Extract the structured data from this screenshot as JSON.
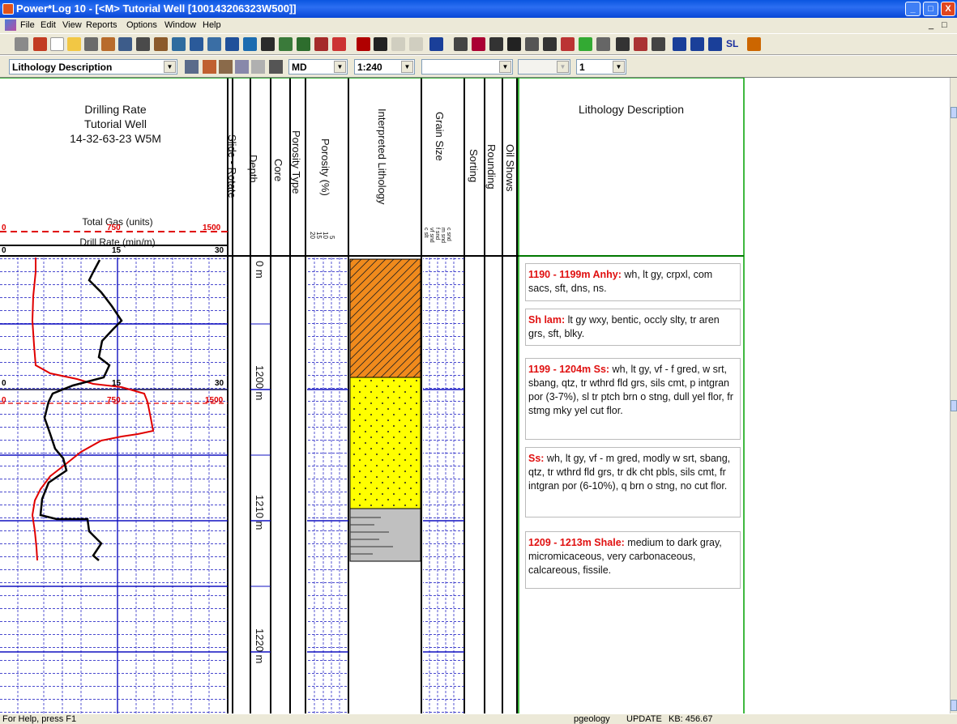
{
  "window": {
    "title": "Power*Log 10 - [<M> Tutorial Well [100143206323W500]]",
    "buttons": [
      "_",
      "□",
      "X"
    ]
  },
  "menu": {
    "items": [
      "File",
      "Edit",
      "View",
      "Reports",
      "Options",
      "Window",
      "Help"
    ],
    "mdi_buttons": [
      "_",
      "□"
    ]
  },
  "toolbar2": {
    "view_select": "Lithology Description",
    "depth_select": "MD",
    "scale_select": "1:240",
    "blank_select": "",
    "disabled_select": "",
    "page_select": "1",
    "sl_label": "SL"
  },
  "headers": {
    "drill_title_1": "Drilling Rate",
    "drill_title_2": "Tutorial Well",
    "drill_title_3": "14-32-63-23 W5M",
    "total_gas": "Total Gas (units)",
    "gas_min": "0",
    "gas_mid": "750",
    "gas_max": "1500",
    "drill_rate": "Drill Rate (min/m)",
    "rate_min": "0",
    "rate_mid": "15",
    "rate_max": "30",
    "slide_rotate": "Slide - Rotate",
    "depth": "Depth",
    "core": "Core",
    "porosity_type": "Porosity Type",
    "porosity": "Porosity (%)",
    "porosity_scale": [
      "20",
      "15",
      "10",
      "5"
    ],
    "interpreted_lithology": "Interpreted Lithology",
    "grain_size": "Grain Size",
    "grain_scale": [
      "c slt",
      "vf snd",
      "f snd",
      "m snd",
      "c snd"
    ],
    "sorting": "Sorting",
    "rounding": "Rounding",
    "oil_shows": "Oil Shows",
    "lithology_description": "Lithology Description"
  },
  "depth_labels": [
    "0 m",
    "1200 m",
    "1210 m",
    "1220 m"
  ],
  "inline_scale": {
    "rate_min": "0",
    "rate_mid": "15",
    "rate_max": "30",
    "gas_min": "0",
    "gas_mid": "750",
    "gas_max": "1500"
  },
  "descriptions": [
    {
      "head": "1190 - 1199m Anhy:",
      "body": " wh, lt gy, crpxl, com sacs, sft, dns, ns."
    },
    {
      "head": "Sh lam:",
      "body": " lt gy wxy, bentic, occly slty, tr aren grs, sft, blky."
    },
    {
      "head": "1199 - 1204m Ss:",
      "body": " wh, lt gy, vf - f gred, w srt, sbang, qtz, tr wthrd fld grs, sils cmt, p intgran por (3-7%), sl tr ptch brn o stng, dull yel flor, fr stmg mky yel cut flor."
    },
    {
      "head": "Ss:",
      "body": " wh, lt gy, vf - m gred, modly w srt, sbang, qtz, tr wthrd fld grs, tr dk cht pbls, sils cmt, fr intgran por (6-10%), q brn o stng, no cut flor."
    },
    {
      "head": "1209 - 1213m Shale:",
      "body": " medium to dark gray, micromicaceous, very carbonaceous, calcareous, fissile."
    }
  ],
  "status": {
    "help": "For Help, press F1",
    "user": "pgeology",
    "mode": "UPDATE",
    "kb": "KB: 456.67"
  },
  "colors": {
    "anhydrite": "#f08a1c",
    "sandstone": "#ffff00",
    "shale": "#c0c0c0",
    "gas_curve": "#e00000",
    "rate_curve": "#000000",
    "grid_blue": "#0000cc",
    "desc_head": "#e01010"
  }
}
